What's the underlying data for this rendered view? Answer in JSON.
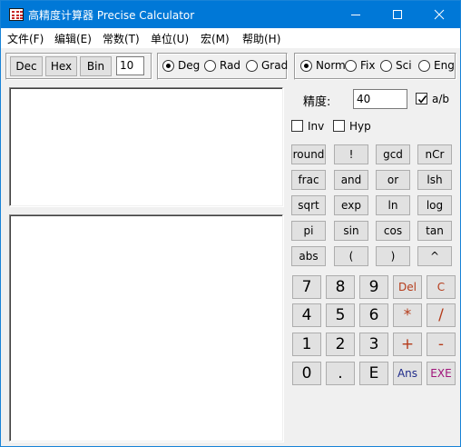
{
  "window": {
    "title": "高精度计算器 Precise Calculator"
  },
  "menu": [
    "文件(F)",
    "编辑(E)",
    "常数(T)",
    "单位(U)",
    "宏(M)",
    "帮助(H)"
  ],
  "base": {
    "buttons": [
      "Dec",
      "Hex",
      "Bin"
    ],
    "value": "10"
  },
  "angle": {
    "options": [
      "Deg",
      "Rad",
      "Grad"
    ],
    "selected": "Deg"
  },
  "format": {
    "options": [
      "Norm",
      "Fix",
      "Sci",
      "Eng"
    ],
    "selected": "Norm"
  },
  "precision": {
    "label": "精度:",
    "value": "40",
    "fraction_label": "a/b",
    "fraction_checked": true
  },
  "modifiers": {
    "inv": "Inv",
    "hyp": "Hyp"
  },
  "functions": [
    [
      "round",
      "!",
      "gcd",
      "nCr"
    ],
    [
      "frac",
      "and",
      "or",
      "lsh"
    ],
    [
      "sqrt",
      "exp",
      "ln",
      "log"
    ],
    [
      "pi",
      "sin",
      "cos",
      "tan"
    ],
    [
      "abs",
      "(",
      ")",
      "^"
    ]
  ],
  "keypad": [
    [
      "7",
      "8",
      "9",
      "Del",
      "C"
    ],
    [
      "4",
      "5",
      "6",
      "*",
      "/"
    ],
    [
      "1",
      "2",
      "3",
      "+",
      "-"
    ],
    [
      "0",
      ".",
      "E",
      "Ans",
      "EXE"
    ]
  ],
  "colors": {
    "titlebar": "#0078d7",
    "operator": "#b53b1a",
    "ans": "#1e2a8a",
    "exe": "#a0147a"
  }
}
